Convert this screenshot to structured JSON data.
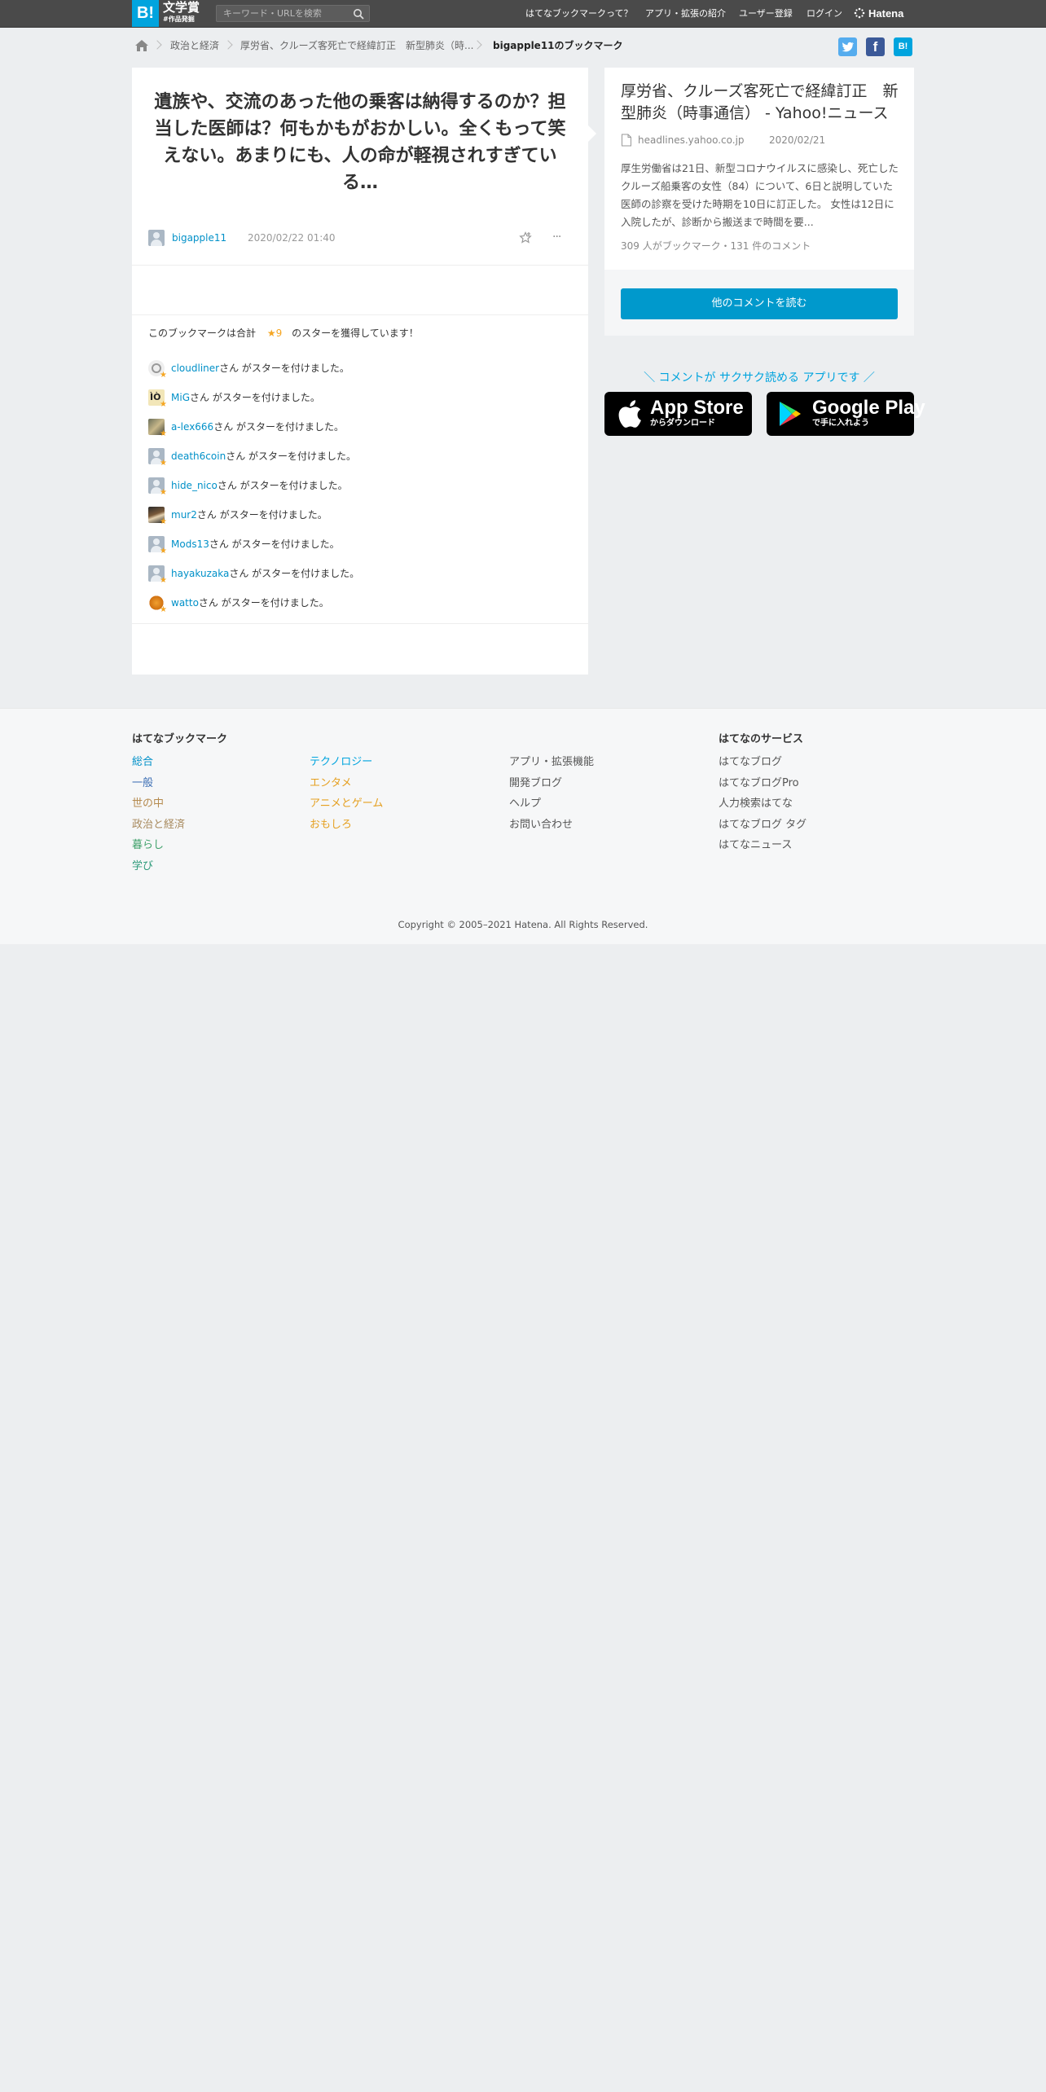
{
  "header": {
    "logo_b": "B!",
    "award_line1": "文学賞",
    "award_line2": "#作品発掘",
    "search_placeholder": "キーワード・URLを検索",
    "nav": [
      "はてなブックマークって？",
      "アプリ・拡張の紹介",
      "ユーザー登録",
      "ログイン"
    ],
    "hatena": "Hatena"
  },
  "breadcrumb": {
    "items": [
      "政治と経済",
      "厚労省、クルーズ客死亡で経緯訂正　新型肺炎（時...",
      "bigapple11のブックマーク"
    ]
  },
  "share": {
    "twitter_icon": "twitter-icon",
    "facebook_label": "f",
    "hatena_label": "B!"
  },
  "bookmark": {
    "comment": "遺族や、交流のあった他の乗客は納得するのか？担当した医師は？何もかもがおかしい。全くもって笑えない。あまりにも、人の命が軽視されすぎている…",
    "user": "bigapple11",
    "datetime": "2020/02/22 01:40",
    "more": "···",
    "stars_prefix": "このブックマークは合計",
    "stars_total": "★9",
    "stars_suffix": "のスターを獲得しています！",
    "star_users": [
      {
        "name": "cloudliner",
        "text": "さん がスターを付けました。"
      },
      {
        "name": "MiG",
        "text": "さん がスターを付けました。"
      },
      {
        "name": "a-lex666",
        "text": "さん がスターを付けました。"
      },
      {
        "name": "death6coin",
        "text": "さん がスターを付けました。"
      },
      {
        "name": "hide_nico",
        "text": "さん がスターを付けました。"
      },
      {
        "name": "mur2",
        "text": "さん がスターを付けました。"
      },
      {
        "name": "Mods13",
        "text": "さん がスターを付けました。"
      },
      {
        "name": "hayakuzaka",
        "text": "さん がスターを付けました。"
      },
      {
        "name": "watto",
        "text": "さん がスターを付けました。"
      }
    ]
  },
  "entry": {
    "title": "厚労省、クルーズ客死亡で経緯訂正　新型肺炎（時事通信） - Yahoo!ニュース",
    "domain": "headlines.yahoo.co.jp",
    "date": "2020/02/21",
    "description": "厚生労働省は21日、新型コロナウイルスに感染し、死亡したクルーズ船乗客の女性（84）について、6日と説明していた医師の診察を受けた時期を10日に訂正した。 女性は12日に入院したが、診断から搬送まで時間を要...",
    "counts": "309 人がブックマーク・131 件のコメント",
    "read_button": "他のコメントを読む"
  },
  "promo": {
    "text": "＼ コメントが サクサク読める アプリです ／",
    "appstore_big": "App Store",
    "appstore_small": "からダウンロード",
    "googleplay_big": "Google Play",
    "googleplay_small": "で手に入れよう"
  },
  "footer": {
    "bookmark_heading": "はてなブックマーク",
    "col1": [
      {
        "label": "総合",
        "color": "#0090c8"
      },
      {
        "label": "一般",
        "color": "#3d6fb5"
      },
      {
        "label": "世の中",
        "color": "#b58a4e"
      },
      {
        "label": "政治と経済",
        "color": "#a88a5e"
      },
      {
        "label": "暮らし",
        "color": "#3fa16a"
      },
      {
        "label": "学び",
        "color": "#2c9a7a"
      }
    ],
    "col2": [
      {
        "label": "テクノロジー",
        "color": "#00a4de"
      },
      {
        "label": "エンタメ",
        "color": "#e5a021"
      },
      {
        "label": "アニメとゲーム",
        "color": "#e5a021"
      },
      {
        "label": "おもしろ",
        "color": "#e5a021"
      }
    ],
    "col3": [
      "アプリ・拡張機能",
      "開発ブログ",
      "ヘルプ",
      "お問い合わせ"
    ],
    "services_heading": "はてなのサービス",
    "services": [
      "はてなブログ",
      "はてなブログPro",
      "人力検索はてな",
      "はてなブログ タグ",
      "はてなニュース"
    ],
    "copyright": "Copyright © 2005–2021 Hatena. All Rights Reserved."
  },
  "colors": {
    "accent": "#00a4de",
    "button": "#0099cc",
    "link": "#0090c8",
    "star": "#f5a623",
    "twitter": "#55acee",
    "facebook": "#3b5998",
    "hatena": "#00a4de"
  }
}
